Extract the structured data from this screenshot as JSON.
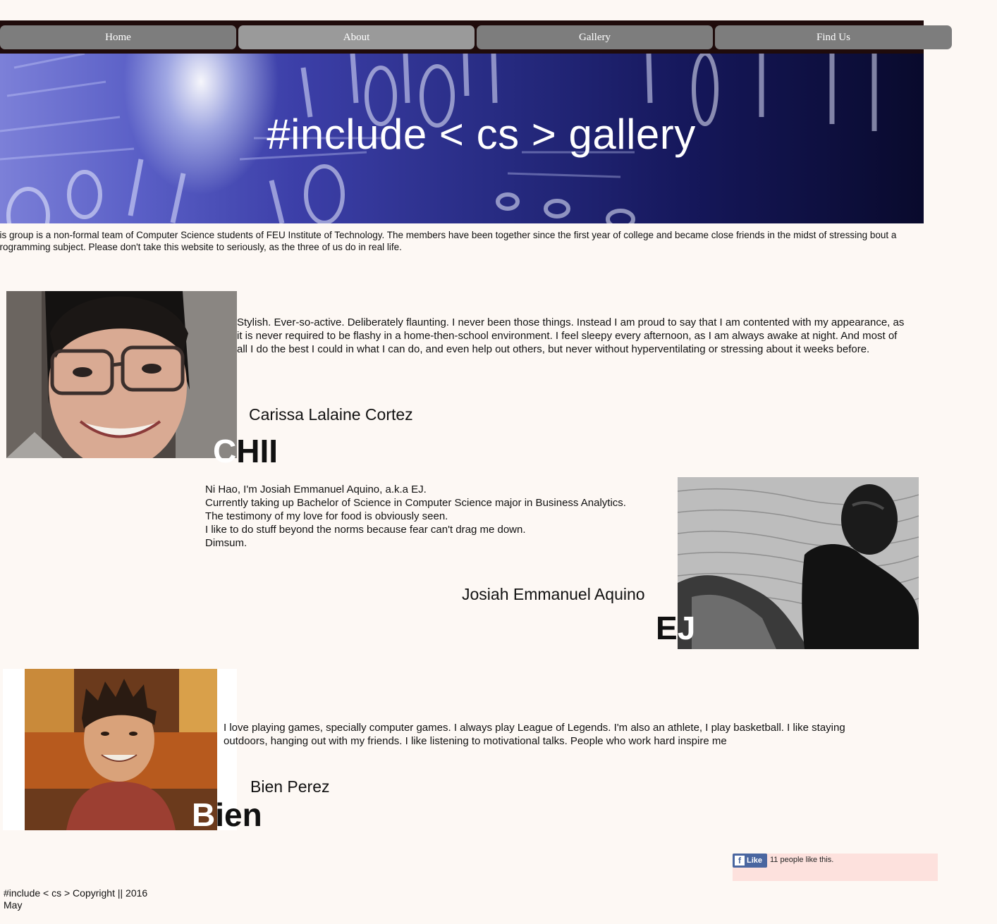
{
  "nav": {
    "items": [
      {
        "label": "Home"
      },
      {
        "label": "About"
      },
      {
        "label": "Gallery"
      },
      {
        "label": "Find Us"
      }
    ],
    "active": "About"
  },
  "banner": {
    "title": "#include < cs > gallery"
  },
  "intro": {
    "text": "his group is a non-formal team of Computer Science students of FEU Institute of Technology. The members have been together since the first year of college and became close friends in the midst of stressing bout a programming subject. Please don't take this website to seriously, as the three of us do in real life."
  },
  "members": [
    {
      "bio": "Stylish. Ever-so-active. Deliberately flaunting. I never been those things. Instead I am proud to say that I am contented with my appearance, as it is never required to be flashy in a home-then-school environment. I feel sleepy every afternoon, as I am always awake at  night. And most of all I do the best I could in what I can do, and even help out others, but never without hyperventilating or stressing about it weeks before.",
      "name": "Carissa Lalaine Cortez",
      "nick_first": "C",
      "nick_rest": "HII"
    },
    {
      "bio_lines": [
        "Ni Hao, I'm Josiah Emmanuel Aquino, a.k.a EJ.",
        "Currently taking up Bachelor of Science in Computer Science major in Business Analytics.",
        "The testimony of my love for food is obviously seen.",
        "I like to do stuff beyond the norms because fear can't drag me down.",
        "Dimsum."
      ],
      "name": "Josiah Emmanuel Aquino",
      "nick_first": "E",
      "nick_rest": "J"
    },
    {
      "bio": "I love playing games, specially computer games. I always play  League of Legends. I'm also an athlete, I play basketball. I like staying outdoors, hanging out with my friends. I like listening to motivational talks. People who work hard inspire me",
      "name": "Bien Perez",
      "nick_first": "B",
      "nick_rest": "ien"
    }
  ],
  "facebook": {
    "like_label": "Like",
    "count_text": "11 people like this."
  },
  "footer": {
    "line1": "#include < cs > Copyright || 2016",
    "line2": "May"
  }
}
